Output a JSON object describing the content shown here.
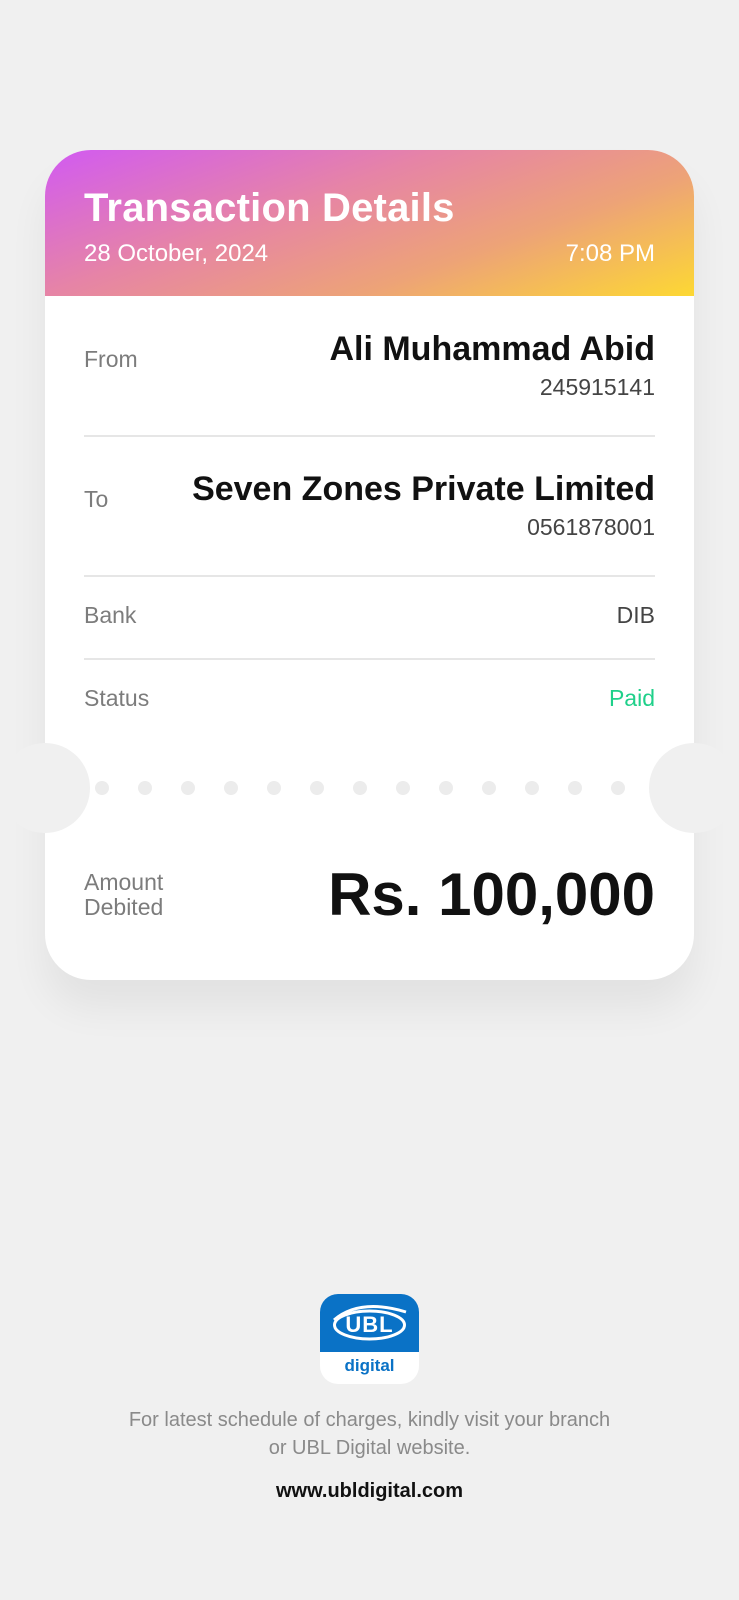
{
  "header": {
    "title": "Transaction Details",
    "date": "28 October, 2024",
    "time": "7:08 PM"
  },
  "details": {
    "from": {
      "label": "From",
      "name": "Ali Muhammad Abid",
      "account": "245915141"
    },
    "to": {
      "label": "To",
      "name": "Seven Zones Private Limited",
      "account": "0561878001"
    },
    "bank": {
      "label": "Bank",
      "value": "DIB"
    },
    "status": {
      "label": "Status",
      "value": "Paid"
    }
  },
  "amount": {
    "label_line1": "Amount",
    "label_line2": "Debited",
    "value": "Rs. 100,000"
  },
  "logo": {
    "brand": "UBL",
    "sub": "digital"
  },
  "footer": {
    "note_line1": "For latest schedule of charges, kindly visit your branch",
    "note_line2": "or UBL Digital website.",
    "link": "www.ubldigital.com"
  },
  "colors": {
    "gradient": [
      "#d15af2",
      "#e684a6",
      "#eda377",
      "#fdd833"
    ],
    "paid": "#1fd08a",
    "brand_blue": "#0a72c6"
  }
}
